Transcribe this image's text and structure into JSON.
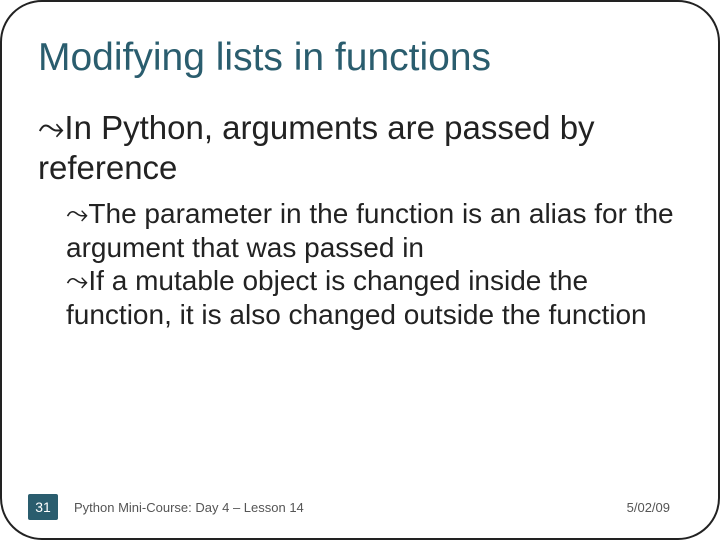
{
  "title": "Modifying lists in functions",
  "bullet_glyph": "⤳",
  "point1": "In Python, arguments are passed by reference",
  "sub1": "The parameter in the function is an alias for the argument that was passed in",
  "sub2": "If a mutable object is changed inside the function, it is also changed outside the function",
  "footer": {
    "page": "31",
    "course": "Python Mini-Course: Day 4 – Lesson 14",
    "date": "5/02/09"
  }
}
